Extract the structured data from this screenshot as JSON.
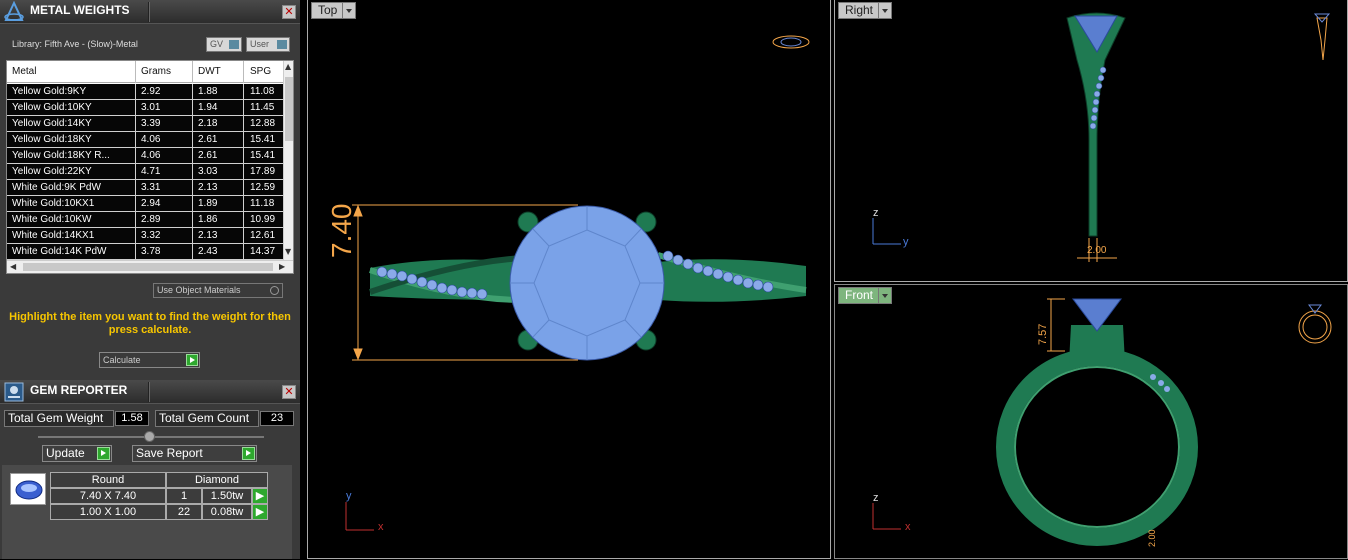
{
  "metal_panel": {
    "title": "METAL WEIGHTS",
    "library": "Library: Fifth Ave - (Slow)-Metal",
    "toggle_gv": "GV",
    "toggle_user": "User",
    "columns": [
      "Metal",
      "Grams",
      "DWT",
      "SPG"
    ],
    "rows": [
      [
        "Yellow Gold:9KY",
        "2.92",
        "1.88",
        "11.08"
      ],
      [
        "Yellow Gold:10KY",
        "3.01",
        "1.94",
        "11.45"
      ],
      [
        "Yellow Gold:14KY",
        "3.39",
        "2.18",
        "12.88"
      ],
      [
        "Yellow Gold:18KY",
        "4.06",
        "2.61",
        "15.41"
      ],
      [
        "Yellow Gold:18KY R...",
        "4.06",
        "2.61",
        "15.41"
      ],
      [
        "Yellow Gold:22KY",
        "4.71",
        "3.03",
        "17.89"
      ],
      [
        "White Gold:9K PdW",
        "3.31",
        "2.13",
        "12.59"
      ],
      [
        "White Gold:10KX1",
        "2.94",
        "1.89",
        "11.18"
      ],
      [
        "White Gold:10KW",
        "2.89",
        "1.86",
        "10.99"
      ],
      [
        "White Gold:14KX1",
        "3.32",
        "2.13",
        "12.61"
      ],
      [
        "White Gold:14K PdW",
        "3.78",
        "2.43",
        "14.37"
      ]
    ],
    "use_object_materials": "Use Object Materials",
    "hint": "Highlight the item you want to find the weight for then press calculate.",
    "calculate": "Calculate"
  },
  "gem_panel": {
    "title": "GEM REPORTER",
    "total_weight_label": "Total Gem Weight",
    "total_weight_value": "1.58",
    "total_count_label": "Total Gem Count",
    "total_count_value": "23",
    "update": "Update",
    "save_report": "Save Report",
    "header_shape": "Round",
    "header_material": "Diamond",
    "gems": [
      {
        "size": "7.40 X 7.40",
        "count": "1",
        "weight": "1.50tw"
      },
      {
        "size": "1.00 X 1.00",
        "count": "22",
        "weight": "0.08tw"
      }
    ]
  },
  "viewports": {
    "top": {
      "label": "Top",
      "dimension": "7.40",
      "axis_y": "y",
      "axis_x": "x"
    },
    "right": {
      "label": "Right",
      "dimension": "2.00",
      "axis_z": "z",
      "axis_y": "y"
    },
    "front": {
      "label": "Front",
      "dimension_side": "7.57",
      "dimension_bottom": "2.00",
      "axis_z": "z",
      "axis_x": "x"
    }
  },
  "colors": {
    "metal_green": "#1f7a52",
    "gem_blue": "#7aa2e8",
    "dimension_orange": "#f4a64a",
    "hint_yellow": "#f7c600",
    "go_green": "#2ea82e"
  }
}
